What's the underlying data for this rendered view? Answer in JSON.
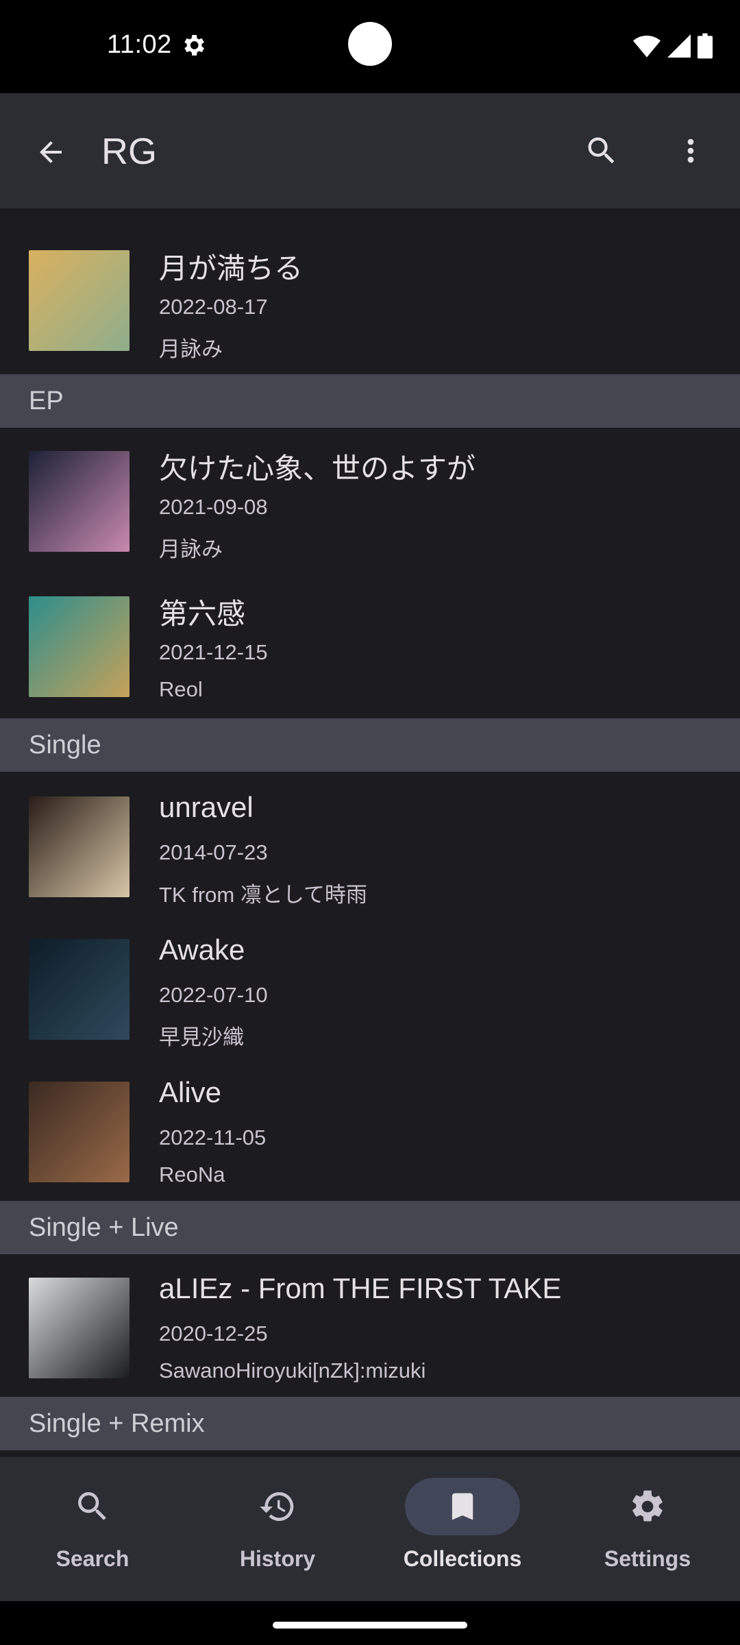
{
  "status_bar": {
    "time": "11:02"
  },
  "app_bar": {
    "title": "RG",
    "back_icon": "arrow-back-icon",
    "search_icon": "search-icon",
    "more_icon": "more-vert-icon"
  },
  "items": [
    {
      "title": "月が満ちる",
      "date": "2022-08-17",
      "artist": "月詠み",
      "art_colors": [
        "#d9b15f",
        "#8fae8c"
      ]
    },
    {
      "title": "欠けた心象、世のよすが",
      "date": "2021-09-08",
      "artist": "月詠み",
      "art_colors": [
        "#1c2238",
        "#c98ab0"
      ]
    },
    {
      "title": "第六感",
      "date": "2021-12-15",
      "artist": "Reol",
      "art_colors": [
        "#2c8f8c",
        "#c7a25a"
      ]
    },
    {
      "title": "unravel",
      "date": "2014-07-23",
      "artist": "TK from 凛として時雨",
      "art_colors": [
        "#2a1c18",
        "#d8c8a8"
      ]
    },
    {
      "title": "Awake",
      "date": "2022-07-10",
      "artist": "早見沙織",
      "art_colors": [
        "#0e1d28",
        "#2f4a5c"
      ]
    },
    {
      "title": "Alive",
      "date": "2022-11-05",
      "artist": "ReoNa",
      "art_colors": [
        "#3a2a22",
        "#9a6a48"
      ]
    },
    {
      "title": "aLIEz - From THE FIRST TAKE",
      "date": "2020-12-25",
      "artist": "SawanoHiroyuki[nZk]:mizuki",
      "art_colors": [
        "#d8dadc",
        "#1a1c20"
      ]
    }
  ],
  "sections": [
    {
      "label": "EP"
    },
    {
      "label": "Single"
    },
    {
      "label": "Single + Live"
    },
    {
      "label": "Single + Remix"
    }
  ],
  "bottom_nav": [
    {
      "label": "Search",
      "icon": "search-icon",
      "active": false
    },
    {
      "label": "History",
      "icon": "history-icon",
      "active": false
    },
    {
      "label": "Collections",
      "icon": "bookmark-icon",
      "active": true
    },
    {
      "label": "Settings",
      "icon": "settings-gear-icon",
      "active": false
    }
  ],
  "colors": {
    "background": "#1c1b1f",
    "app_bar": "#2b2d32",
    "section_header": "#45464f",
    "active_pill": "#414659"
  }
}
